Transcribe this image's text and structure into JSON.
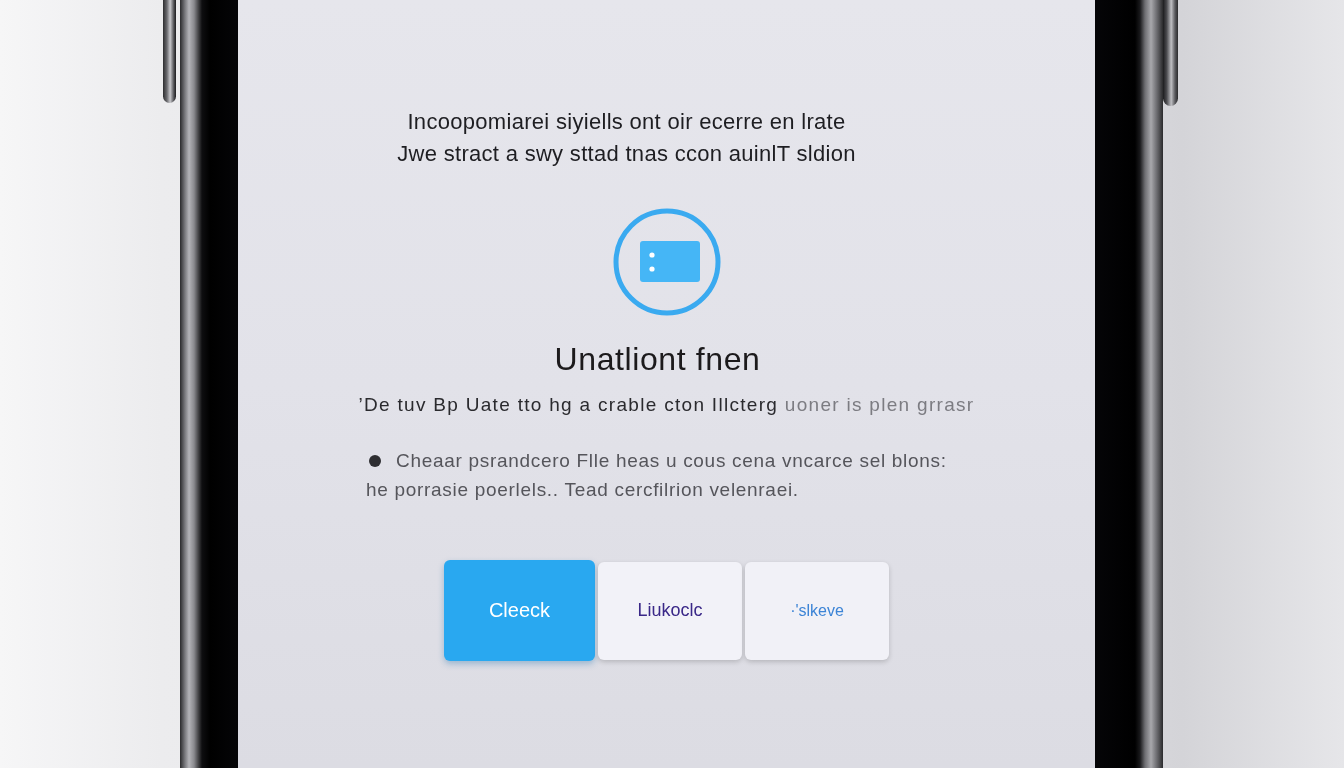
{
  "headline": {
    "lines": [
      "Incoopomiarei siyiells ont oir ecerre en lrate",
      "Jwe stract a swy sttad tnas ccon auinlT sldion"
    ]
  },
  "title": "Unatliont fnen",
  "subtitle": {
    "text": "’De tuv Bp Uate tto hg a crable cton Illcterg",
    "faded_tail": "uoner is plen grrasr"
  },
  "bullets": [
    {
      "lines": [
        "Cheaar psrandcero Flle heas u cous cena vncarce sel blons:",
        "he porrasie poerlels.. Tead cercfilrion velenraei."
      ]
    }
  ],
  "buttons": [
    {
      "label": "Cleeck",
      "kind": "primary"
    },
    {
      "label": "Liukoclc",
      "kind": "secondary"
    },
    {
      "label": "·'slkeve",
      "kind": "tertiary"
    }
  ]
}
